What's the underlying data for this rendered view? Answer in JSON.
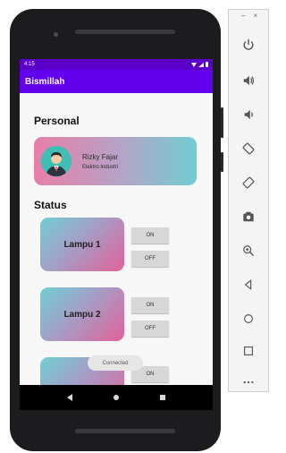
{
  "app": {
    "status_time": "4:15",
    "title": "Bismillah"
  },
  "personal": {
    "heading": "Personal",
    "name": "Rizky Fajar",
    "department": "Elektro Industri"
  },
  "status": {
    "heading": "Status",
    "lamps": [
      {
        "label": "Lampu 1",
        "on_label": "ON",
        "off_label": "OFF"
      },
      {
        "label": "Lampu 2",
        "on_label": "ON",
        "off_label": "OFF"
      },
      {
        "label": "",
        "on_label": "ON",
        "off_label": ""
      }
    ]
  },
  "toast": "Connected",
  "emulator_panel": {
    "window_buttons": [
      "–",
      "×"
    ],
    "tools": [
      "power-icon",
      "volume-up-icon",
      "volume-down-icon",
      "rotate-left-icon",
      "rotate-right-icon",
      "camera-icon",
      "zoom-icon",
      "back-icon",
      "home-icon",
      "overview-icon",
      "more-icon"
    ]
  },
  "colors": {
    "status_bar": "#5a00c9",
    "app_bar": "#6200ee",
    "gradient_pink": "#e26197",
    "gradient_teal": "#71cfd3"
  }
}
